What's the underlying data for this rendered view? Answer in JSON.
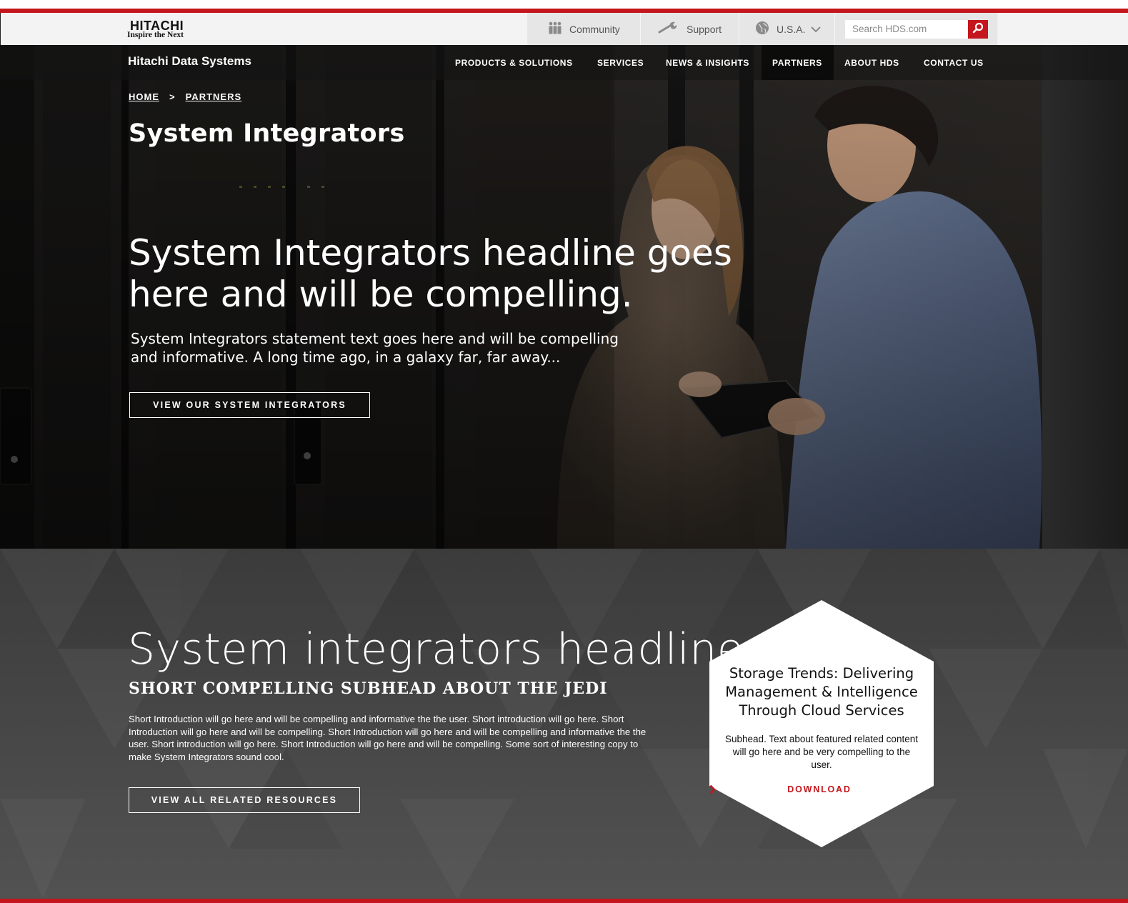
{
  "brand": {
    "logo_text": "HITACHI",
    "logo_tagline": "Inspire the Next",
    "site_name": "Hitachi Data Systems"
  },
  "utility_nav": {
    "community": "Community",
    "support": "Support",
    "country": "U.S.A.",
    "search_placeholder": "Search HDS.com"
  },
  "main_nav": {
    "items": [
      {
        "label": "PRODUCTS & SOLUTIONS"
      },
      {
        "label": "SERVICES"
      },
      {
        "label": "NEWS & INSIGHTS"
      },
      {
        "label": "PARTNERS",
        "active": true
      },
      {
        "label": "ABOUT HDS"
      },
      {
        "label": "CONTACT US"
      }
    ]
  },
  "breadcrumb": {
    "home": "HOME",
    "separator": ">",
    "current": "PARTNERS"
  },
  "hero": {
    "page_title": "System Integrators",
    "headline": "System Integrators headline goes here and will be compelling.",
    "statement": "System Integrators statement text goes here and will be compelling and informative. A long time ago, in a galaxy far, far away...",
    "button_label": "VIEW OUR SYSTEM INTEGRATORS"
  },
  "section": {
    "headline": "System integrators headline",
    "subhead": "SHORT COMPELLING SUBHEAD ABOUT THE JEDI",
    "intro": "Short Introduction will go here and will be compelling and informative the the user. Short introduction will go here. Short Introduction will go here and will be compelling. Short Introduction will go here and will be compelling and informative the the user. Short introduction will go here. Short Introduction will go here and will be compelling. Some sort of interesting copy to make System Integrators sound cool.",
    "button_label": "VIEW ALL RELATED RESOURCES"
  },
  "featured": {
    "title": "Storage Trends: Delivering Management & Intelligence Through Cloud Services",
    "subhead": "Subhead. Text about featured related content will go here and be very compelling to the user.",
    "download_label": "DOWNLOAD"
  },
  "colors": {
    "accent_red": "#c4161c",
    "hero_dark": "#141313",
    "section_gray": "#4a4a4a"
  },
  "icons": [
    "community-icon",
    "wrench-icon",
    "globe-icon",
    "chevron-down-icon",
    "search-icon",
    "chevron-right-icon"
  ]
}
